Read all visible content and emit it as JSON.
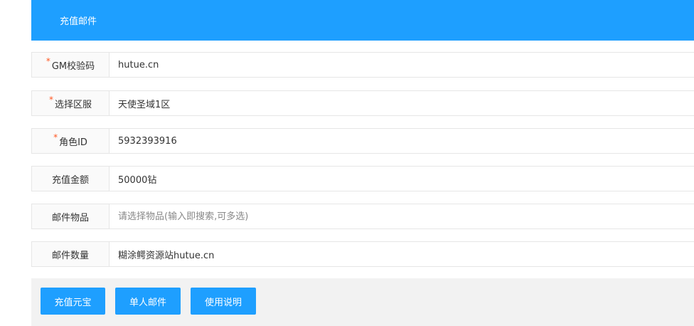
{
  "header": {
    "title": "充值邮件"
  },
  "form": {
    "rows": [
      {
        "label": "GM校验码",
        "required": true,
        "value": "hutue.cn",
        "placeholder": ""
      },
      {
        "label": "选择区服",
        "required": true,
        "value": "天使圣域1区",
        "placeholder": ""
      },
      {
        "label": "角色ID",
        "required": true,
        "value": "5932393916",
        "placeholder": ""
      },
      {
        "label": "充值金额",
        "required": false,
        "value": "50000钻",
        "placeholder": ""
      },
      {
        "label": "邮件物品",
        "required": false,
        "value": "",
        "placeholder": "请选择物品(输入即搜索,可多选)"
      },
      {
        "label": "邮件数量",
        "required": false,
        "value": "糊涂鳄资源站hutue.cn",
        "placeholder": ""
      }
    ],
    "required_mark": "*"
  },
  "buttons": {
    "recharge": "充值元宝",
    "single_mail": "单人邮件",
    "instructions": "使用说明"
  },
  "colors": {
    "primary": "#1e9fff",
    "required": "#ff5722",
    "label_bg": "#fafafa",
    "footer_bg": "#f2f2f2",
    "border": "#e6e6e6"
  }
}
